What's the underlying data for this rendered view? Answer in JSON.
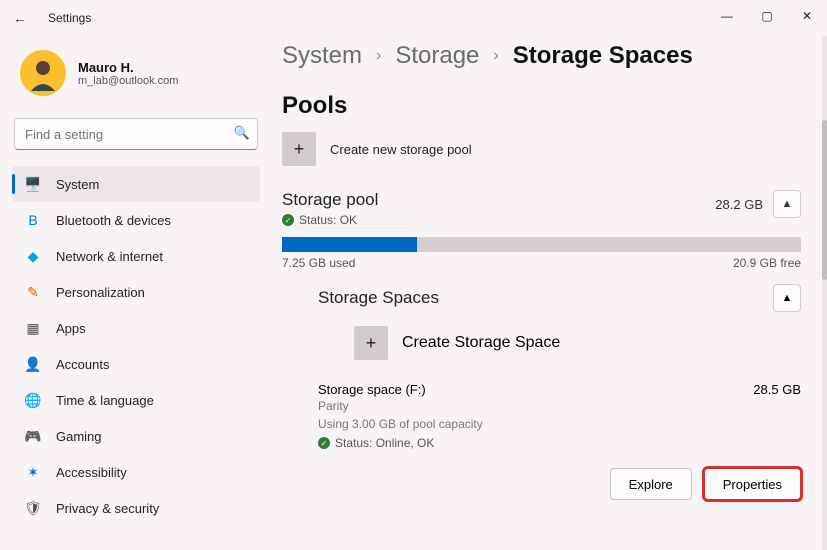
{
  "window": {
    "title": "Settings"
  },
  "profile": {
    "name": "Mauro H.",
    "email": "m_lab@outlook.com"
  },
  "search": {
    "placeholder": "Find a setting"
  },
  "sidebar": {
    "items": [
      {
        "label": "System",
        "icon": "🖥️",
        "color": "#0078d4"
      },
      {
        "label": "Bluetooth & devices",
        "icon": "B",
        "color": "#0078d4"
      },
      {
        "label": "Network & internet",
        "icon": "◆",
        "color": "#00a3e0"
      },
      {
        "label": "Personalization",
        "icon": "✎",
        "color": "#c46a00"
      },
      {
        "label": "Apps",
        "icon": "▦",
        "color": "#555"
      },
      {
        "label": "Accounts",
        "icon": "👤",
        "color": "#2e7d32"
      },
      {
        "label": "Time & language",
        "icon": "🌐",
        "color": "#0078d4"
      },
      {
        "label": "Gaming",
        "icon": "🎮",
        "color": "#888"
      },
      {
        "label": "Accessibility",
        "icon": "✶",
        "color": "#0067c0"
      },
      {
        "label": "Privacy & security",
        "icon": "🛡",
        "color": "#555"
      }
    ]
  },
  "breadcrumb": {
    "a": "System",
    "b": "Storage",
    "c": "Storage Spaces",
    "sep": "›"
  },
  "pools": {
    "heading": "Pools",
    "create_label": "Create new storage pool",
    "pool": {
      "name": "Storage pool",
      "size": "28.2 GB",
      "status_label": "Status: OK",
      "used": "7.25 GB used",
      "free": "20.9 GB free",
      "used_pct": 26
    },
    "spaces": {
      "heading": "Storage Spaces",
      "create_label": "Create Storage Space",
      "item": {
        "name": "Storage space (F:)",
        "size": "28.5 GB",
        "type": "Parity",
        "usage": "Using 3.00 GB of pool capacity",
        "status": "Status: Online, OK"
      }
    },
    "actions": {
      "explore": "Explore",
      "properties": "Properties"
    }
  }
}
